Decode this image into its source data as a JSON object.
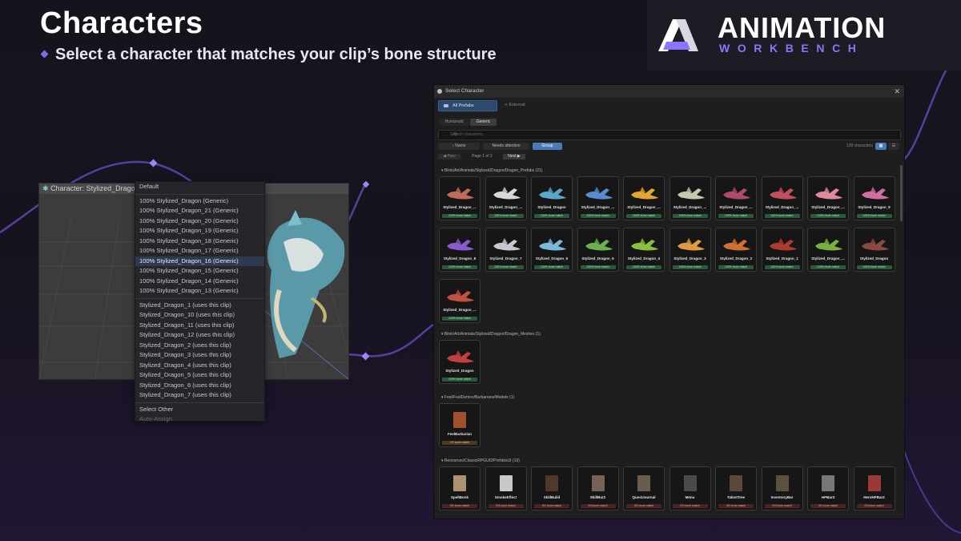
{
  "header": {
    "title": "Characters",
    "subtitle": "Select a character that matches your clip’s bone structure"
  },
  "brand": {
    "name_line1": "ANIMATION",
    "name_line2": "WORKBENCH",
    "accent": "#8d74ff"
  },
  "viewport": {
    "bar_label": "Character: Stylized_Dragon_"
  },
  "dropdown": {
    "default_label": "Default",
    "generic_items": [
      "100%  Stylized_Dragon   (Generic)",
      "100%  Stylized_Dragon_21   (Generic)",
      "100%  Stylized_Dragon_20   (Generic)",
      "100%  Stylized_Dragon_19   (Generic)",
      "100%  Stylized_Dragon_18   (Generic)",
      "100%  Stylized_Dragon_17   (Generic)",
      "100%  Stylized_Dragon_16   (Generic)",
      "100%  Stylized_Dragon_15   (Generic)",
      "100%  Stylized_Dragon_14   (Generic)",
      "100%  Stylized_Dragon_13   (Generic)"
    ],
    "selected_index": 6,
    "clip_items": [
      "Stylized_Dragon_1   (uses this clip)",
      "Stylized_Dragon_10   (uses this clip)",
      "Stylized_Dragon_11   (uses this clip)",
      "Stylized_Dragon_12   (uses this clip)",
      "Stylized_Dragon_2   (uses this clip)",
      "Stylized_Dragon_3   (uses this clip)",
      "Stylized_Dragon_4   (uses this clip)",
      "Stylized_Dragon_5   (uses this clip)",
      "Stylized_Dragon_6   (uses this clip)",
      "Stylized_Dragon_7   (uses this clip)"
    ],
    "select_other": "Select Other",
    "auto_assign": "Auto-Assign"
  },
  "dialog": {
    "title": "Select Character",
    "tabs": [
      "All Prefabs",
      "External"
    ],
    "rig_types": [
      "Humanoid",
      "Generic"
    ],
    "search_placeholder": "Search characters...",
    "filters": [
      "↕ Name",
      "Needs attention",
      "Group"
    ],
    "count": "139 characters",
    "prev": "◀ Prev",
    "page": "Page 1 of 2",
    "next": "Next ▶",
    "sections": [
      {
        "header": "▾ Blink/Art/Animals/Stylized/Dragon/Dragon_Prefabs  (21)",
        "cards": [
          {
            "name": "Stylized_Dragon_...",
            "match": "100% bone match",
            "color": "#c46a5a"
          },
          {
            "name": "Stylized_Dragon_...",
            "match": "100% bone match",
            "color": "#d8d8d8"
          },
          {
            "name": "Stylized_Dragon",
            "match": "100% bone match",
            "color": "#5aa8c8"
          },
          {
            "name": "Stylized_Dragon_...",
            "match": "100% bone match",
            "color": "#5a8ad0"
          },
          {
            "name": "Stylized_Dragon_...",
            "match": "100% bone match",
            "color": "#e0a830"
          },
          {
            "name": "Stylized_Dragon_...",
            "match": "100% bone match",
            "color": "#c8c8b0"
          },
          {
            "name": "Stylized_Dragon_...",
            "match": "100% bone match",
            "color": "#b04a6a"
          },
          {
            "name": "Stylized_Dragon_...",
            "match": "100% bone match",
            "color": "#c05060"
          },
          {
            "name": "Stylized_Dragon_...",
            "match": "100% bone match",
            "color": "#e08aa0"
          },
          {
            "name": "Stylized_Dragon_9",
            "match": "100% bone match",
            "color": "#d070a0"
          },
          {
            "name": "Stylized_Dragon_8",
            "match": "100% bone match",
            "color": "#8a5ad0"
          },
          {
            "name": "Stylized_Dragon_7",
            "match": "100% bone match",
            "color": "#c8c8d0"
          },
          {
            "name": "Stylized_Dragon_6",
            "match": "100% bone match",
            "color": "#7ab8d8"
          },
          {
            "name": "Stylized_Dragon_5",
            "match": "100% bone match",
            "color": "#6ab050"
          },
          {
            "name": "Stylized_Dragon_4",
            "match": "100% bone match",
            "color": "#8ac040"
          },
          {
            "name": "Stylized_Dragon_3",
            "match": "100% bone match",
            "color": "#e09a40"
          },
          {
            "name": "Stylized_Dragon_2",
            "match": "100% bone match",
            "color": "#d07030"
          },
          {
            "name": "Stylized_Dragon_1",
            "match": "100% bone match",
            "color": "#b03a30"
          },
          {
            "name": "Stylized_Dragon_...",
            "match": "100% bone match",
            "color": "#7ab040"
          },
          {
            "name": "Stylized_Dragon",
            "match": "100% bone match",
            "color": "#8a4a40"
          },
          {
            "name": "Stylized_Dragon_...",
            "match": "100% bone match",
            "color": "#c05040"
          }
        ]
      },
      {
        "header": "▾ Blink/Art/Animals/Stylized/Dragon/Dragon_Meshes  (1)",
        "cards": [
          {
            "name": "Stylized_Dragon",
            "match": "100% bone match",
            "color": "#c04040"
          }
        ]
      },
      {
        "header": "▾ Feel/FeelDemos/Barbarians/Models  (1)",
        "cards": [
          {
            "name": "FeelBarbarian",
            "match": "1% bone match",
            "color": "#b85a30"
          }
        ]
      },
      {
        "header": "▾ Resources/ClassicRPGUI2/PrefabsUI  (19)",
        "cards": [
          {
            "name": "SpellBook",
            "match": "0% bone match",
            "color": "#c8a880"
          },
          {
            "name": "SmokeEffect",
            "match": "0% bone match",
            "color": "#e8e8e8"
          },
          {
            "name": "SkillBuild",
            "match": "0% bone match",
            "color": "#5a4030"
          },
          {
            "name": "SkillBar2",
            "match": "0% bone match",
            "color": "#8a7060"
          },
          {
            "name": "QuestJournal",
            "match": "0% bone match",
            "color": "#7a6a58"
          },
          {
            "name": "Menu",
            "match": "0% bone match",
            "color": "#555555"
          },
          {
            "name": "TalentTree",
            "match": "0% bone match",
            "color": "#6a5040"
          },
          {
            "name": "InventoryBar",
            "match": "0% bone match",
            "color": "#6a5a48"
          },
          {
            "name": "HPBar3",
            "match": "0% bone match",
            "color": "#888888"
          },
          {
            "name": "HeroHPBar2",
            "match": "0% bone match",
            "color": "#b04040"
          }
        ]
      }
    ]
  }
}
